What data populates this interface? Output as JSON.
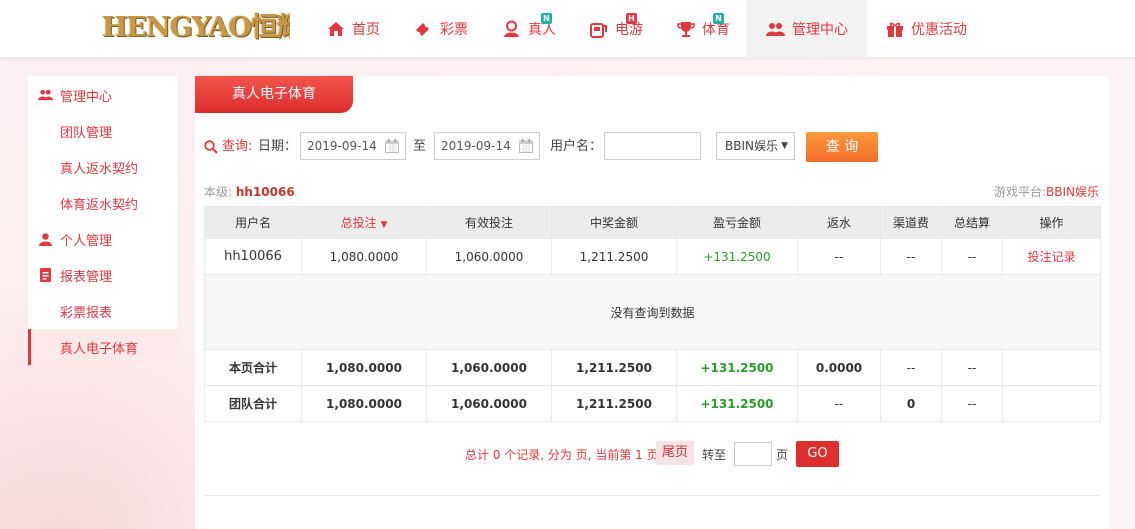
{
  "brand": {
    "logo_text": "HENGYAO恒耀",
    "accent_color": "#e0383e"
  },
  "nav": {
    "items": [
      {
        "label": "首页",
        "icon": "home-icon",
        "badge": ""
      },
      {
        "label": "彩票",
        "icon": "ticket-icon",
        "badge": ""
      },
      {
        "label": "真人",
        "icon": "dealer-icon",
        "badge": "N"
      },
      {
        "label": "电游",
        "icon": "slot-machine-icon",
        "badge": "H"
      },
      {
        "label": "体育",
        "icon": "trophy-icon",
        "badge": "N"
      },
      {
        "label": "管理中心",
        "icon": "users-icon",
        "badge": "",
        "active": true
      },
      {
        "label": "优惠活动",
        "icon": "gift-icon",
        "badge": ""
      }
    ]
  },
  "sidebar": {
    "items": [
      {
        "label": "管理中心",
        "type": "group",
        "icon": "users-icon"
      },
      {
        "label": "团队管理",
        "type": "sub"
      },
      {
        "label": "真人返水契约",
        "type": "sub"
      },
      {
        "label": "体育返水契约",
        "type": "sub"
      },
      {
        "label": "个人管理",
        "type": "group",
        "icon": "user-icon"
      },
      {
        "label": "报表管理",
        "type": "group",
        "icon": "report-icon"
      },
      {
        "label": "彩票报表",
        "type": "sub"
      },
      {
        "label": "真人电子体育",
        "type": "sub",
        "active": true
      }
    ]
  },
  "panel": {
    "tab_label": "真人电子体育"
  },
  "filter": {
    "query_label": "查询:",
    "date_label": "日期：",
    "start_date": "2019-09-14",
    "to_label": "至",
    "end_date": "2019-09-14",
    "username_label": "用户名：",
    "username_value": "",
    "platform_selected": "BBIN娱乐",
    "submit_label": "查 询"
  },
  "info": {
    "level_label": "本级:",
    "level_user": "hh10066",
    "platform_label": "游戏平台:",
    "platform_value": "BBIN娱乐"
  },
  "table": {
    "headers": [
      "用户名",
      "总投注",
      "有效投注",
      "中奖金额",
      "盈亏金额",
      "返水",
      "渠道费",
      "总结算",
      "操作"
    ],
    "sort_indicator": "▼",
    "row": [
      "hh10066",
      "1,080.0000",
      "1,060.0000",
      "1,211.2500",
      "+131.2500",
      "--",
      "--",
      "--",
      "投注记录"
    ],
    "empty_message": "没有查询到数据",
    "page_total": [
      "本页合计",
      "1,080.0000",
      "1,060.0000",
      "1,211.2500",
      "+131.2500",
      "0.0000",
      "--",
      "--",
      ""
    ],
    "team_total": [
      "团队合计",
      "1,080.0000",
      "1,060.0000",
      "1,211.2500",
      "+131.2500",
      "--",
      "0",
      "--",
      ""
    ]
  },
  "pager": {
    "summary": "总计 0 个记录, 分为 页, 当前第 1 页",
    "last_label": "尾页",
    "goto_label": "转至",
    "page_unit": "页",
    "go_label": "GO"
  }
}
